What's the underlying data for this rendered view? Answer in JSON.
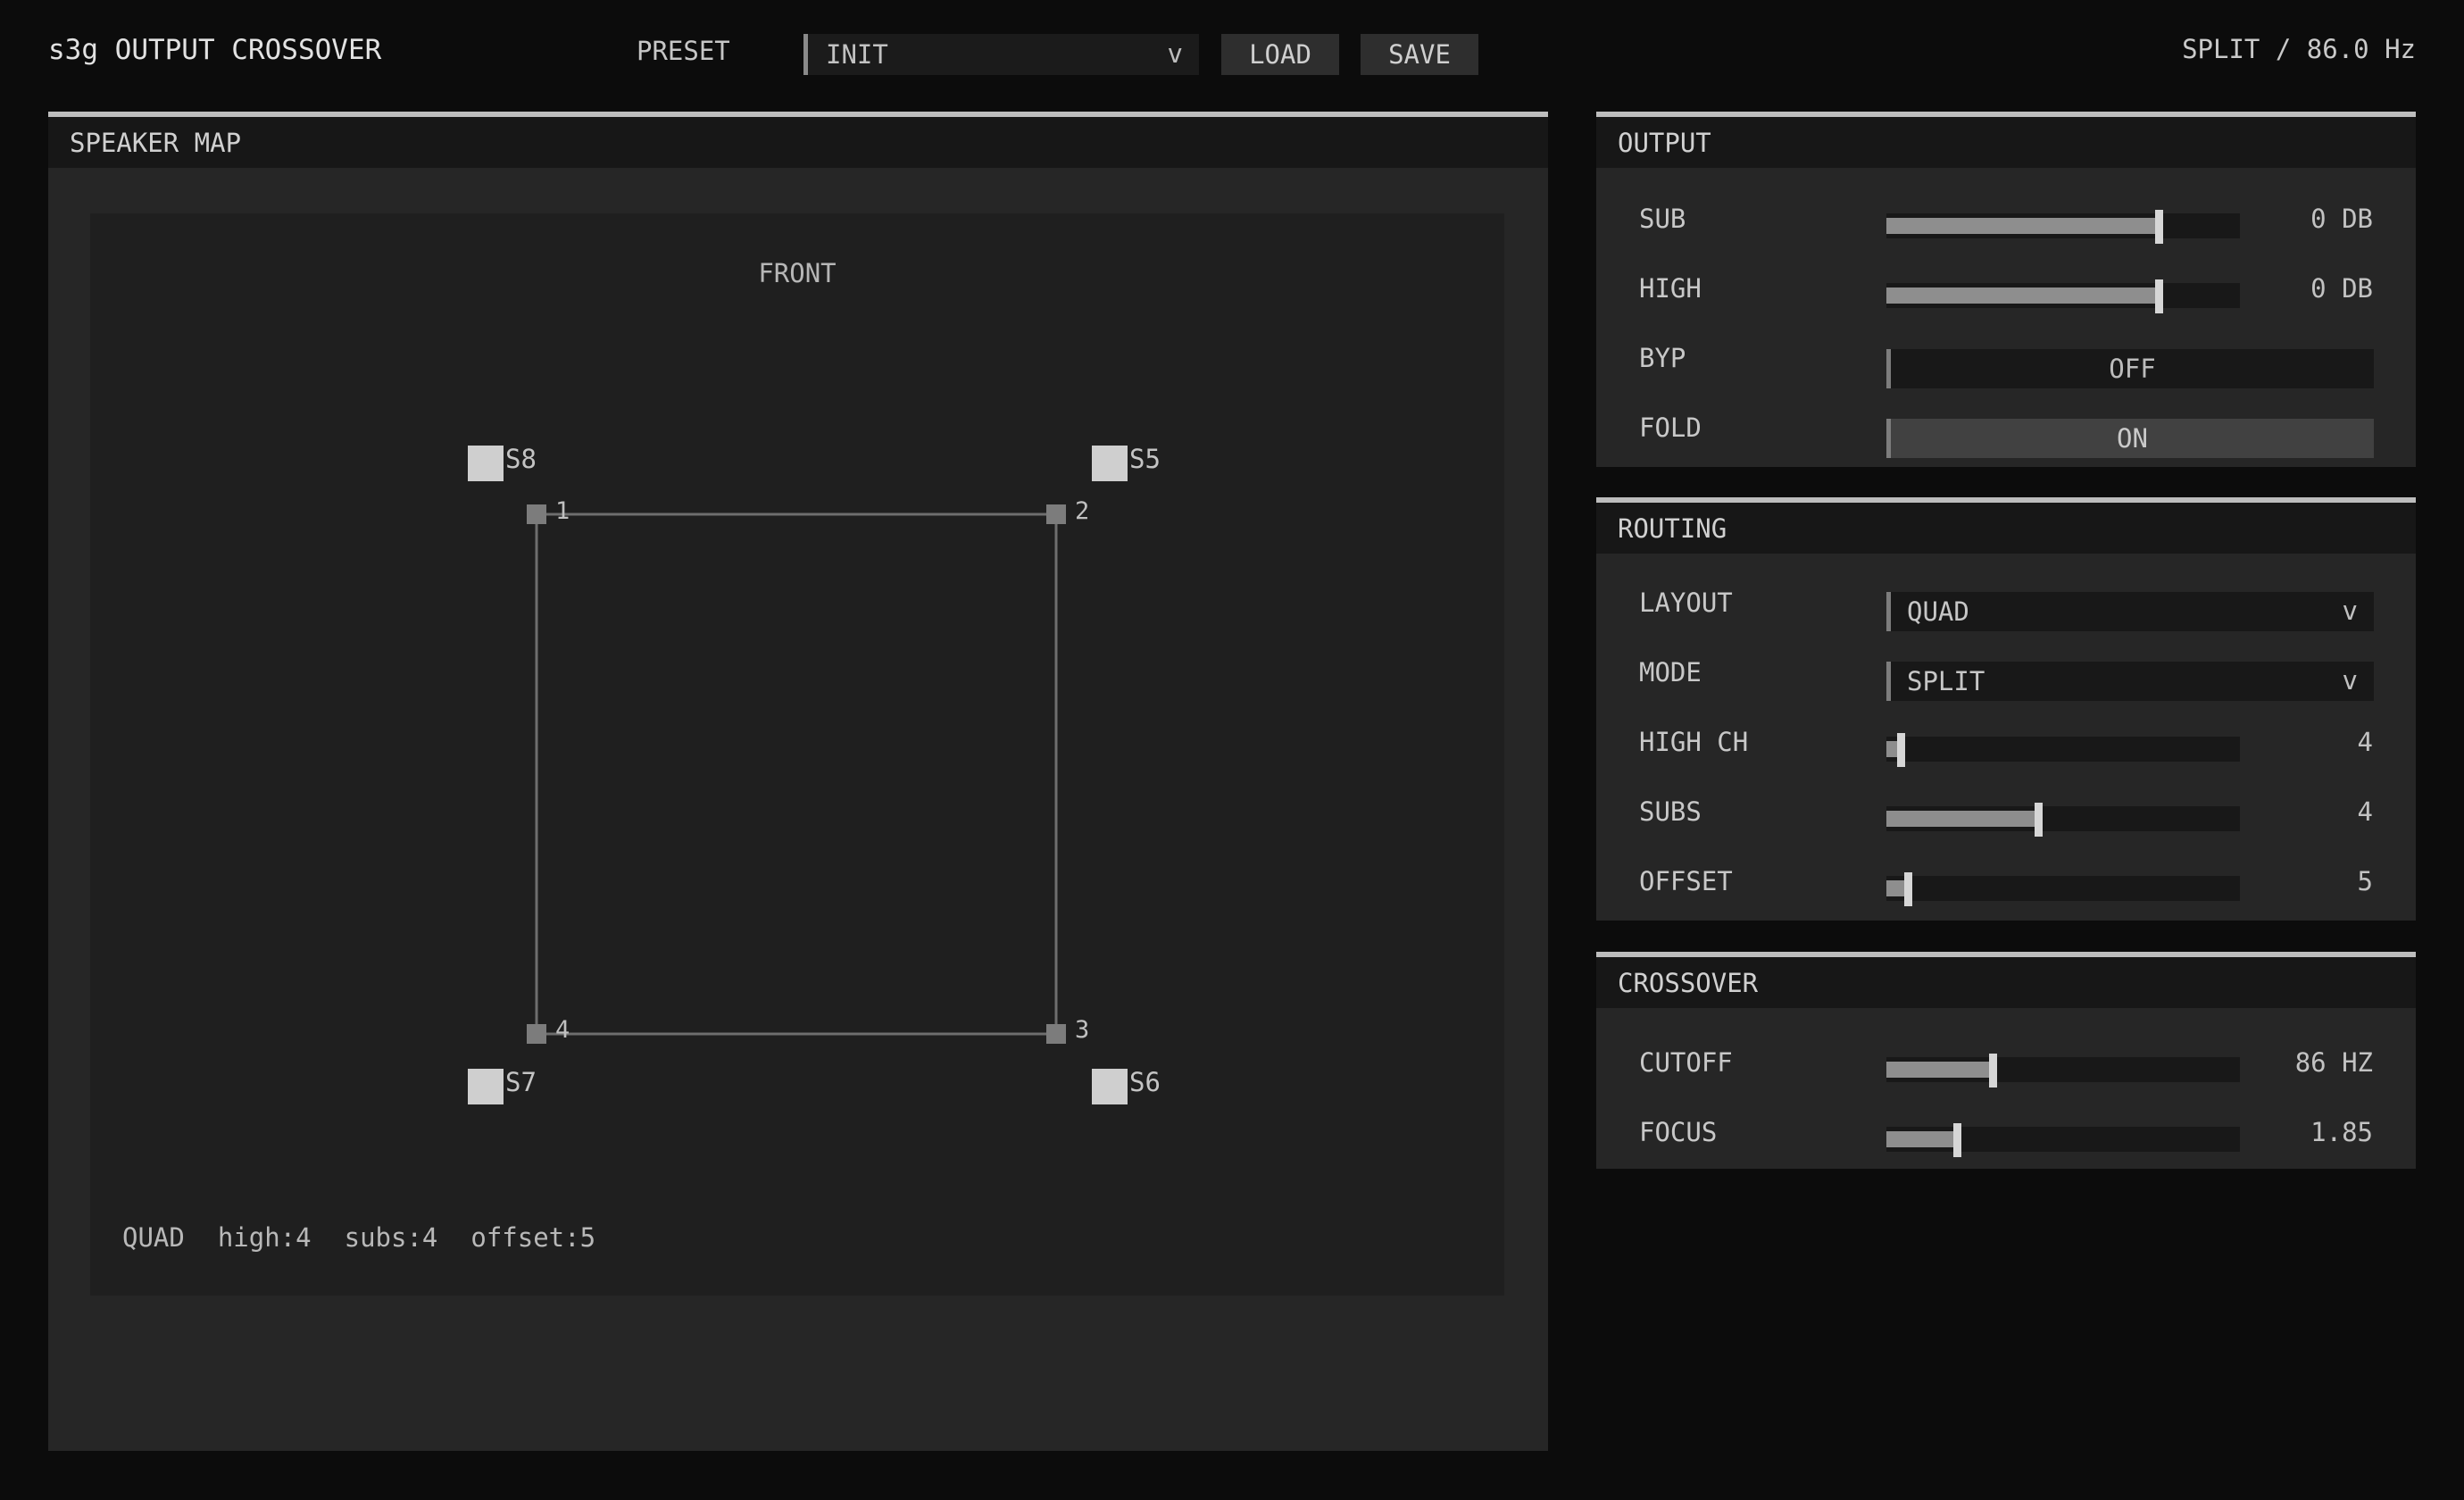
{
  "header": {
    "title": "s3g OUTPUT CROSSOVER",
    "preset_label": "PRESET",
    "preset_value": "INIT",
    "chevron": "v",
    "load_label": "LOAD",
    "save_label": "SAVE",
    "status": "SPLIT / 86.0 Hz"
  },
  "speaker_map": {
    "title": "SPEAKER MAP",
    "front_label": "FRONT",
    "speakers": [
      {
        "label": "S8"
      },
      {
        "label": "S5"
      },
      {
        "label": "S7"
      },
      {
        "label": "S6"
      }
    ],
    "nodes": [
      {
        "label": "1"
      },
      {
        "label": "2"
      },
      {
        "label": "3"
      },
      {
        "label": "4"
      }
    ],
    "summary": {
      "layout": "QUAD",
      "high": "high:4",
      "subs": "subs:4",
      "offset": "offset:5"
    }
  },
  "output": {
    "title": "OUTPUT",
    "sub": {
      "label": "SUB",
      "value": "0 DB",
      "level": 0.77
    },
    "high": {
      "label": "HIGH",
      "value": "0 DB",
      "level": 0.77
    },
    "byp": {
      "label": "BYP",
      "value": "OFF"
    },
    "fold": {
      "label": "FOLD",
      "value": "ON"
    }
  },
  "routing": {
    "title": "ROUTING",
    "layout": {
      "label": "LAYOUT",
      "value": "QUAD"
    },
    "mode": {
      "label": "MODE",
      "value": "SPLIT"
    },
    "high_ch": {
      "label": "HIGH CH",
      "value": "4",
      "level": 0.04
    },
    "subs": {
      "label": "SUBS",
      "value": "4",
      "level": 0.43
    },
    "offset": {
      "label": "OFFSET",
      "value": "5",
      "level": 0.06
    }
  },
  "crossover": {
    "title": "CROSSOVER",
    "cutoff": {
      "label": "CUTOFF",
      "value": "86 HZ",
      "level": 0.3
    },
    "focus": {
      "label": "FOCUS",
      "value": "1.85",
      "level": 0.2
    }
  },
  "colors": {
    "background": "#0c0c0c",
    "panel": "#262626",
    "accent": "#bdbdbd"
  }
}
